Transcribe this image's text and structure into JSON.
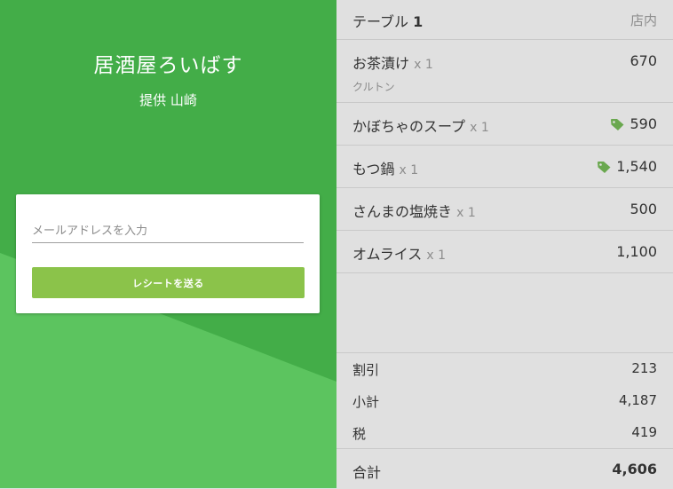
{
  "colors": {
    "left_background": "#43ad48",
    "wave_light": "#5cc45f",
    "button": "#8bc34a",
    "tag_icon": "#6aa84f"
  },
  "shop": {
    "name": "居酒屋ろいばす",
    "provider": "提供 山崎"
  },
  "receipt_form": {
    "email_placeholder": "メールアドレスを入力",
    "email_value": "",
    "send_label": "レシートを送る"
  },
  "order": {
    "table_prefix": "テーブル",
    "table_number": "1",
    "dine_type": "店内",
    "items": [
      {
        "name": "お茶漬け",
        "qty": "x 1",
        "price": "670",
        "note": "クルトン",
        "icon": ""
      },
      {
        "name": "かぼちゃのスープ",
        "qty": "x 1",
        "price": "590",
        "note": "",
        "icon": "tag-icon"
      },
      {
        "name": "もつ鍋",
        "qty": "x 1",
        "price": "1,540",
        "note": "",
        "icon": "tag-icon"
      },
      {
        "name": "さんまの塩焼き",
        "qty": "x 1",
        "price": "500",
        "note": "",
        "icon": ""
      },
      {
        "name": "オムライス",
        "qty": "x 1",
        "price": "1,100",
        "note": "",
        "icon": ""
      }
    ]
  },
  "summary": {
    "discount_label": "割引",
    "discount_value": "213",
    "subtotal_label": "小計",
    "subtotal_value": "4,187",
    "tax_label": "税",
    "tax_value": "419",
    "total_label": "合計",
    "total_value": "4,606"
  }
}
